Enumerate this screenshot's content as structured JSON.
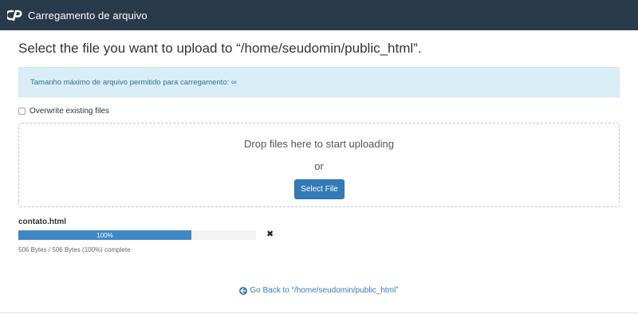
{
  "header": {
    "logo_icon": "cpanel-logo-icon",
    "title": "Carregamento de arquivo"
  },
  "main": {
    "heading": "Select the file you want to upload to “/home/seudomin/public_html”.",
    "info_text": "Tamanho máximo de arquivo permitido para carregamento: ∞",
    "overwrite_label": "Overwrite existing files",
    "overwrite_checked": false
  },
  "dropzone": {
    "drop_text": "Drop files here to start uploading",
    "or_text": "or",
    "select_label": "Select File"
  },
  "upload": {
    "file_name": "contato.html",
    "progress_label": "100%",
    "progress_fraction": 1.0,
    "remove_icon": "close-icon",
    "status_text": "506 Bytes / 506 Bytes (100%) complete"
  },
  "footer": {
    "back_icon": "arrow-left-circle-icon",
    "back_label": "Go Back to “/home/seudomin/public_html”"
  },
  "colors": {
    "topbar": "#293a4a",
    "accent": "#337ab7",
    "info_bg": "#d9edf7",
    "progress": "#3f88c5"
  }
}
